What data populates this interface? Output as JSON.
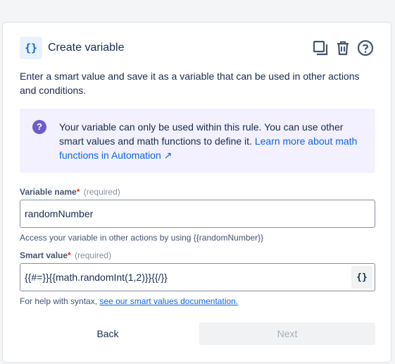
{
  "dialog": {
    "icon_text": "{}",
    "title": "Create variable",
    "description": "Enter a smart value and save it as a variable that can be used in other actions and conditions."
  },
  "info": {
    "text": "Your variable can only be used within this rule. You can use other smart values and math functions to define it. ",
    "link_text": "Learn more about math functions in Automation ↗",
    "icon_glyph": "?"
  },
  "variable_name": {
    "label": "Variable name",
    "required_marker": "*",
    "required_text": "(required)",
    "value": "randomNumber",
    "helper": "Access your variable in other actions by using {{randomNumber}}"
  },
  "smart_value": {
    "label": "Smart value",
    "required_marker": "*",
    "required_text": "(required)",
    "value": "{{#=}}{{math.randomInt(1,2)}}{{/}}",
    "button_text": "{}",
    "helper_prefix": "For help with syntax, ",
    "helper_link": "see our smart values documentation."
  },
  "footer": {
    "back_label": "Back",
    "next_label": "Next"
  },
  "icons": [
    "braces-icon",
    "copy-icon",
    "trash-icon",
    "help-icon",
    "question-icon"
  ]
}
